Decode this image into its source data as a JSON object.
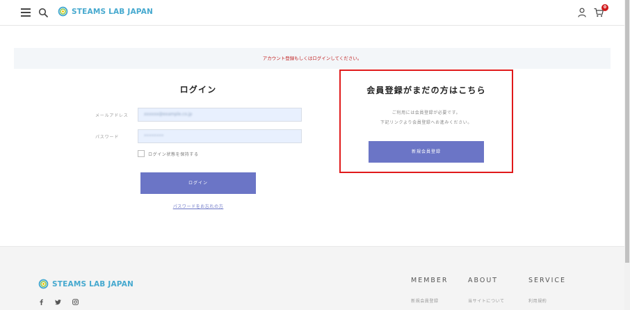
{
  "header": {
    "brand": "STEAMS LAB JAPAN",
    "cart_count": "0",
    "icons": [
      "menu-icon",
      "search-icon",
      "logo-icon",
      "user-icon",
      "cart-icon"
    ]
  },
  "notice": {
    "text": "アカウント登録もしくはログインしてください。"
  },
  "login": {
    "title": "ログイン",
    "email_label": "メールアドレス",
    "email_value": "xxxxxx@example.co.jp",
    "password_label": "パスワード",
    "password_value": "••••••••",
    "remember_label": "ログイン状態を保持する",
    "button_label": "ログイン",
    "forgot_link": "パスワードをお忘れの方"
  },
  "register": {
    "title": "会員登録がまだの方はこちら",
    "desc_line1": "ご利用には会員登録が必要です。",
    "desc_line2": "下記リンクより会員登録へお進みください。",
    "button_label": "新規会員登録"
  },
  "footer": {
    "brand": "STEAMS LAB JAPAN",
    "social_icons": [
      "facebook-icon",
      "twitter-icon",
      "instagram-icon"
    ],
    "columns": [
      {
        "heading": "MEMBER",
        "first_link": "新規会員登録"
      },
      {
        "heading": "ABOUT",
        "first_link": "当サイトについて"
      },
      {
        "heading": "SERVICE",
        "first_link": "利用規約"
      }
    ]
  },
  "colors": {
    "accent": "#6b75c6",
    "brand": "#46a9cf",
    "notice_text": "#c02020",
    "highlight_border": "#e0191a",
    "badge": "#d0191a"
  }
}
